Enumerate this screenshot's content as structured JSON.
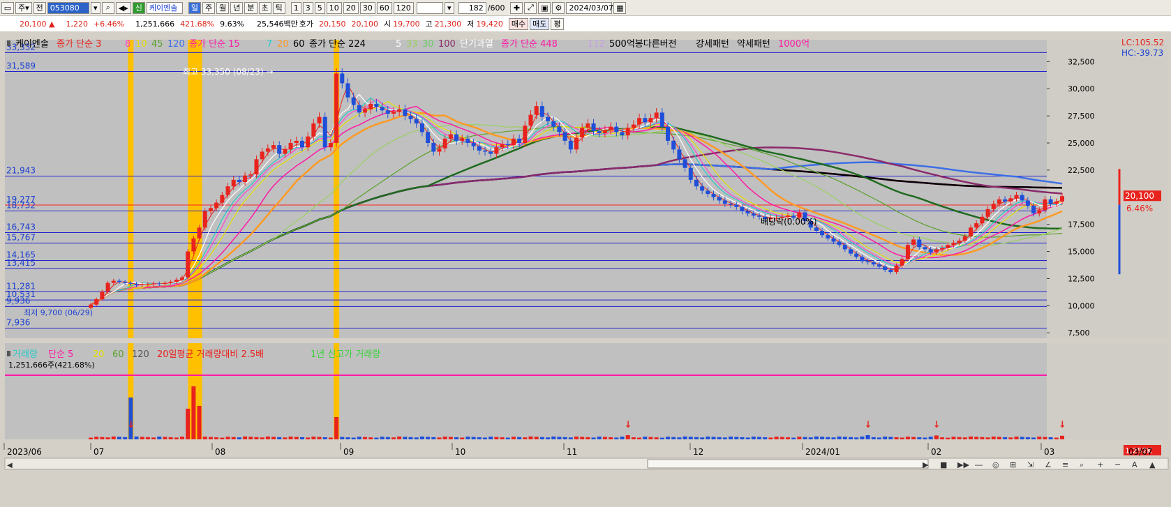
{
  "toolbar": {
    "period_sel": "주",
    "prev_label": "전",
    "code": "053080",
    "credit_label": "신",
    "stock_name": "케이엔솔",
    "tabs": [
      "일",
      "주",
      "월",
      "년",
      "분",
      "초",
      "틱"
    ],
    "nums": [
      "1",
      "3",
      "5",
      "10",
      "20",
      "30",
      "60",
      "120"
    ],
    "count": "182",
    "count_total": "/600",
    "date": "2024/03/07"
  },
  "quote": {
    "price": "20,100",
    "change": "1,220",
    "change_pct": "+6.46%",
    "volume": "1,251,666",
    "vol_ratio": "421.68%",
    "turnover": "9.63%",
    "amount": "25,546백만",
    "ask_label": "호가",
    "ask1": "20,150",
    "ask2": "20,100",
    "open_label": "시",
    "open": "19,700",
    "high_label": "고",
    "high": "21,300",
    "low_label": "저",
    "low": "19,420",
    "buy": "매수",
    "sell": "매도",
    "flat": "평"
  },
  "legend_price": [
    {
      "text": "케이엔솔",
      "color": "#000000"
    },
    {
      "text": "종가 단순 3",
      "color": "#e8231d"
    },
    {
      "text": "8",
      "color": "#ff44c8"
    },
    {
      "text": "10",
      "color": "#e6e000"
    },
    {
      "text": "45",
      "color": "#5aa02c"
    },
    {
      "text": "120",
      "color": "#3d6fe6"
    },
    {
      "text": "종가 단순 15",
      "color": "#ff1aa6"
    },
    {
      "text": "7",
      "color": "#26c8c8"
    },
    {
      "text": "20",
      "color": "#ff9a24"
    },
    {
      "text": "60",
      "color": "#000000"
    },
    {
      "text": "종가 단순 224",
      "color": "#000000"
    },
    {
      "text": "5",
      "color": "#ffffff"
    },
    {
      "text": "33",
      "color": "#9ad060"
    },
    {
      "text": "30",
      "color": "#66cc66"
    },
    {
      "text": "100",
      "color": "#8a2a6a"
    },
    {
      "text": "단기과열",
      "color": "#ffffff"
    },
    {
      "text": "종가 단순 448",
      "color": "#ff1aa6"
    },
    {
      "text": "112",
      "color": "#c6a0e0"
    },
    {
      "text": "500억봉다른버전",
      "color": "#000000"
    },
    {
      "text": "강세패턴",
      "color": "#000000"
    },
    {
      "text": "약세패턴",
      "color": "#000000"
    },
    {
      "text": "1000억",
      "color": "#ff1aa6"
    }
  ],
  "right_top": {
    "lc": "LC:105.52",
    "hc": "HC:-39.73"
  },
  "hlines": [
    "33,332",
    "31,589",
    "21,943",
    "19,277",
    "18,732",
    "16,743",
    "15,767",
    "14,165",
    "13,415",
    "11,281",
    "10,531",
    "9,936",
    "7,936"
  ],
  "y_ticks": [
    "32,500",
    "30,000",
    "27,500",
    "25,000",
    "22,500",
    "17,500",
    "15,000",
    "12,500",
    "10,000",
    "7,500"
  ],
  "price_tag": {
    "price": "20,100",
    "pct": "6.46%"
  },
  "annotations": {
    "high": "최고 33,350 (08/23) →",
    "dividend": "배당락(0.00%)",
    "low": "최저 9,700 (06/29)"
  },
  "volume_legend": [
    {
      "text": "거래량",
      "color": "#26c8c8"
    },
    {
      "text": "단순 5",
      "color": "#ff1aa6"
    },
    {
      "text": "20",
      "color": "#e6e000"
    },
    {
      "text": "60",
      "color": "#5aa02c"
    },
    {
      "text": "120",
      "color": "#555555"
    },
    {
      "text": "20일평균 거래량대비 2.5배",
      "color": "#e8231d"
    },
    {
      "text": "1년 신고가 거래량",
      "color": "#3ad23a"
    }
  ],
  "volume_note": "1,251,666주(421.68%)",
  "volume_tag": {
    "value": "1,252K",
    "pct": "421.68%"
  },
  "x_labels": [
    "2023/06",
    "07",
    "08",
    "09",
    "10",
    "11",
    "12",
    "2024/01",
    "02",
    "03"
  ],
  "x_end": "03/07",
  "chart_data": {
    "type": "candlestick",
    "title": "",
    "ylabel": "",
    "xlabel": "",
    "ylim": [
      7000,
      34000
    ],
    "volume_ylim": [
      0,
      2000000
    ],
    "legend_position": "top-left",
    "grid": false,
    "close_series": [
      10100,
      10600,
      11300,
      12100,
      12300,
      12200,
      12100,
      12000,
      11900,
      11950,
      12000,
      12050,
      12000,
      12100,
      12200,
      12400,
      12600,
      15000,
      16200,
      17200,
      18700,
      19000,
      19500,
      20200,
      21000,
      21600,
      21400,
      22000,
      22100,
      23500,
      24200,
      24500,
      24800,
      24000,
      24400,
      25000,
      25200,
      24600,
      25600,
      26800,
      27400,
      24600,
      25000,
      31400,
      30500,
      29200,
      28500,
      27800,
      28100,
      28600,
      28300,
      28000,
      27700,
      27900,
      28100,
      27500,
      27200,
      26800,
      26000,
      25000,
      24200,
      24500,
      25400,
      25800,
      25200,
      25400,
      25000,
      24700,
      24300,
      24200,
      24000,
      24600,
      24900,
      24800,
      25400,
      25000,
      26600,
      27600,
      28400,
      27400,
      27000,
      26500,
      26000,
      25200,
      24400,
      25500,
      26400,
      26800,
      26100,
      25900,
      26200,
      26500,
      26000,
      25700,
      26400,
      26700,
      27300,
      26900,
      27300,
      27800,
      26500,
      25200,
      24400,
      23500,
      22700,
      21600,
      21000,
      20600,
      20300,
      20000,
      19700,
      19400,
      19300,
      19100,
      18700,
      18500,
      18300,
      18200,
      18000,
      18100,
      18100,
      18200,
      18300,
      18100,
      18600,
      17800,
      17200,
      16900,
      16500,
      16200,
      15900,
      15600,
      15200,
      14800,
      14500,
      14100,
      14000,
      13800,
      13600,
      13300,
      13100,
      13700,
      14300,
      15600,
      16100,
      15400,
      15200,
      14900,
      15200,
      15300,
      15600,
      15800,
      16000,
      16400,
      17200,
      17600,
      18200,
      18900,
      19400,
      19800,
      19600,
      19900,
      20200,
      19700,
      19200,
      18500,
      18800,
      19800,
      19400,
      19600,
      20100
    ],
    "dividend_index": 126,
    "high_point": {
      "value": 33350,
      "date": "08/23"
    },
    "low_point": {
      "value": 9700,
      "date": "06/29"
    },
    "moving_average_periods": [
      3,
      5,
      7,
      8,
      10,
      15,
      20,
      33,
      45,
      60,
      100,
      112,
      120,
      224,
      448
    ],
    "last_volume": 1251666,
    "volume_ratio_pct": 421.68,
    "volume_spikes_by_index": {
      "7": 1500000,
      "17": 1100000,
      "18": 1900000,
      "19": 1200000,
      "43": 800000,
      "94": 150000,
      "136": 150000,
      "148": 140000,
      "170": 130000,
      "180": 1251666
    }
  }
}
